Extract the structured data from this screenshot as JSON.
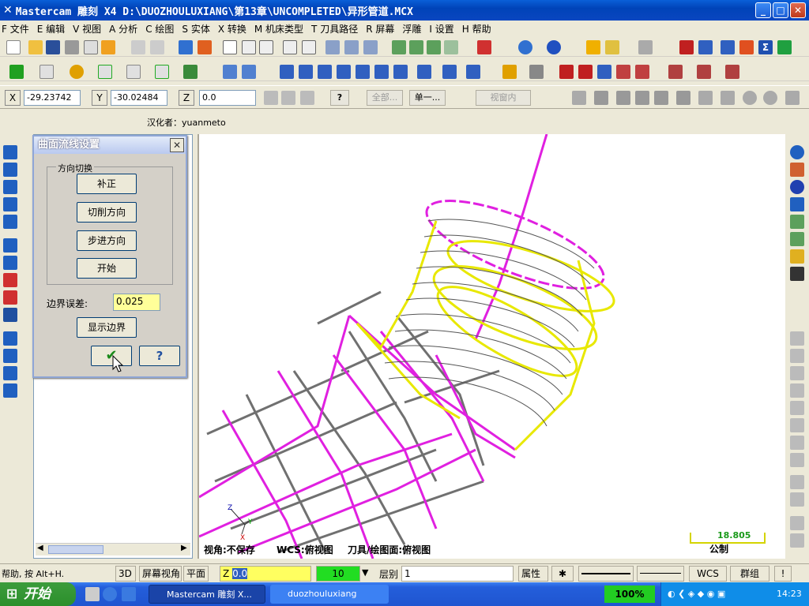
{
  "window": {
    "title": "Mastercam 雕刻 X4   D:\\DUOZHOULUXIANG\\第13章\\UNCOMPLETED\\异形管道.MCX",
    "min": "_",
    "max": "□",
    "close": "✕"
  },
  "menu": [
    "F 文件",
    "E 编辑",
    "V 视图",
    "A 分析",
    "C 绘图",
    "S 实体",
    "X 转换",
    "M 机床类型",
    "T 刀具路径",
    "R 屏幕",
    "浮雕",
    "I 设置",
    "H 帮助"
  ],
  "coords": {
    "x_label": "X",
    "x_value": "-29.23742",
    "y_label": "Y",
    "y_value": "-30.02484",
    "z_label": "Z",
    "z_value": "0.0",
    "btn_all": "全部...",
    "btn_single": "单一...",
    "view_window": "视窗内"
  },
  "localizer": "汉化者：yuanmeto",
  "dialog": {
    "title": "曲面流线设置",
    "group": "方向切换",
    "buttons": [
      "补正",
      "切削方向",
      "步进方向",
      "开始"
    ],
    "tolerance_label": "边界误差:",
    "tolerance_value": "0.025",
    "show_boundary": "显示边界",
    "ok": "✔",
    "help": "?"
  },
  "viewport": {
    "view_info": "视角:不保存",
    "wcs_info": "WCS:俯视图",
    "tool_plane": "刀具/绘图面:俯视图",
    "scale_value": "18.805",
    "units": "公制"
  },
  "statusbar": {
    "help": "帮助, 按 Alt+H.",
    "d3": "3D",
    "screen_view": "屏幕视角",
    "plane": "平面",
    "z_label": "Z",
    "z_value": "0.0",
    "color_value": "10",
    "level_label": "层别",
    "level_value": "1",
    "attr": "属性",
    "wcs": "WCS",
    "group": "群组",
    "excl": "!"
  },
  "taskbar": {
    "start": "开始",
    "task1": "Mastercam 雕刻 X...",
    "task2": "duozhouluxiang",
    "zoom": "100%",
    "clock": "14:23"
  },
  "colors": {
    "magenta": "#e020e0",
    "yellow": "#e8e800",
    "gray": "#707070",
    "tolerance_bg": "#ffff99",
    "color_box": "#22dd22"
  }
}
